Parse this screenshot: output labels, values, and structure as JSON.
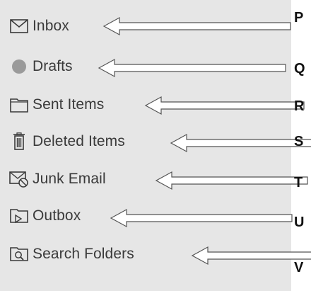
{
  "folders": [
    {
      "label": "Inbox",
      "icon": "envelope-icon",
      "letter": "P"
    },
    {
      "label": "Drafts",
      "icon": "drafts-icon",
      "letter": "Q"
    },
    {
      "label": "Sent Items",
      "icon": "folder-icon",
      "letter": "R"
    },
    {
      "label": "Deleted Items",
      "icon": "trash-icon",
      "letter": "S"
    },
    {
      "label": "Junk Email",
      "icon": "junk-icon",
      "letter": "T"
    },
    {
      "label": "Outbox",
      "icon": "outbox-icon",
      "letter": "U"
    },
    {
      "label": "Search Folders",
      "icon": "search-folder-icon",
      "letter": "V"
    }
  ],
  "colors": {
    "panel": "#e6e6e6",
    "text": "#3a3a3a",
    "arrow_stroke": "#555555",
    "drafts_dot": "#9a9a9a"
  }
}
